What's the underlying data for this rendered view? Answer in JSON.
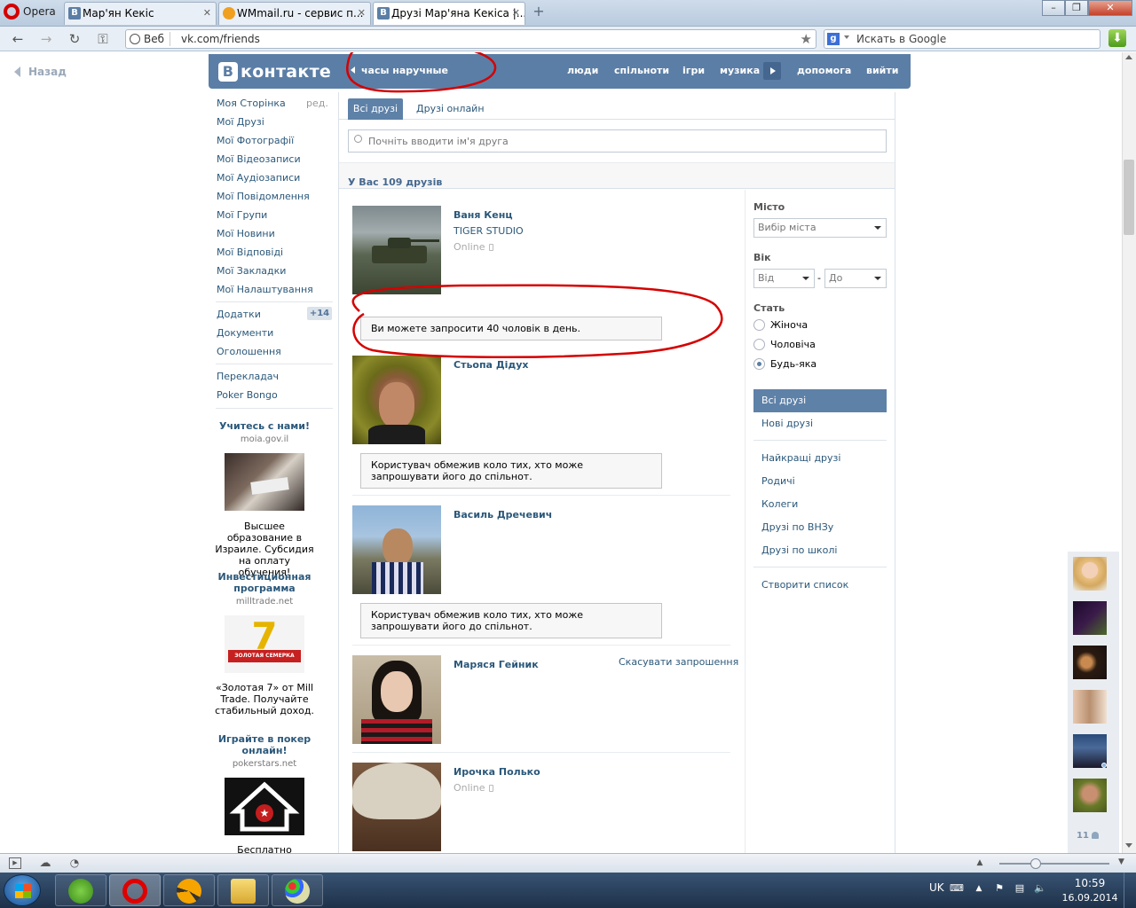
{
  "browser": {
    "menu_label": "Opera",
    "tabs": [
      {
        "label": "Мар'ян Кекіс",
        "icon": "vk-icon"
      },
      {
        "label": "WMmail.ru - сервис п...",
        "icon": "wmmail-icon"
      },
      {
        "label": "Друзі Мар'яна Кекіса |...",
        "icon": "vk-icon",
        "active": true
      }
    ],
    "web_label": "Веб",
    "url": "vk.com/friends",
    "search_placeholder": "Искать в Google"
  },
  "page": {
    "back_label": "Назад"
  },
  "vk_header": {
    "logo_text": "контакте",
    "logo_letter": "В",
    "now_playing": "часы наручные",
    "nav": [
      "люди",
      "спільноти",
      "ігри",
      "музика",
      "допомога",
      "вийти"
    ]
  },
  "left_menu": {
    "items": [
      "Моя Сторінка",
      "Мої Друзі",
      "Мої Фотографії",
      "Мої Відеозаписи",
      "Мої Аудіозаписи",
      "Мої Повідомлення",
      "Мої Групи",
      "Мої Новини",
      "Мої Відповіді",
      "Мої Закладки",
      "Мої Налаштування"
    ],
    "edit_label": "ред.",
    "extra_items": [
      "Додатки",
      "Документи",
      "Оголошення"
    ],
    "apps_badge": "+14",
    "more_items": [
      "Перекладач",
      "Poker Bongo"
    ]
  },
  "ads": [
    {
      "title": "Учитесь с нами!",
      "domain": "moia.gov.il",
      "text": "Высшее образование в Израиле. Субсидия на оплату обучения!"
    },
    {
      "title": "Инвестиционная программа",
      "domain": "milltrade.net",
      "text": "«Золотая 7» от Mill Trade. Получайте стабильный доход.",
      "img_text": "ЗОЛОТАЯ СЕМЕРКА"
    },
    {
      "title": "Играйте в покер онлайн!",
      "domain": "pokerstars.net",
      "text": "Бесплатно скачайте"
    }
  ],
  "friends_page": {
    "tabs": [
      "Всі друзі",
      "Друзі онлайн"
    ],
    "search_placeholder": "Почніть вводити ім'я друга",
    "count_label": "У Вас 109 друзів",
    "friends": [
      {
        "name": "Ваня Кенц",
        "sub": "TIGER STUDIO",
        "status": "Online"
      },
      {
        "name": "Стьопа Дідух"
      },
      {
        "name": "Василь Дречевич"
      },
      {
        "name": "Маряся Гейник",
        "action": "Скасувати запрошення"
      },
      {
        "name": "Ирочка Полько",
        "status": "Online"
      }
    ],
    "tips": [
      "Ви можете запросити 40 чоловік в день.",
      "Користувач обмежив коло тих, хто може запрошувати його до спільнот.",
      "Користувач обмежив коло тих, хто може запрошувати його до спільнот."
    ]
  },
  "filters": {
    "city_label": "Місто",
    "city_value": "Вибір міста",
    "age_label": "Вік",
    "age_from": "Від",
    "age_sep": "-",
    "age_to": "До",
    "gender_label": "Стать",
    "gender_options": [
      "Жіноча",
      "Чоловіча",
      "Будь-яка"
    ],
    "gender_selected": "Будь-яка",
    "lists": [
      "Всі друзі",
      "Нові друзі"
    ],
    "lists2": [
      "Найкращі друзі",
      "Родичі",
      "Колеги",
      "Друзі по ВНЗу",
      "Друзі по школі"
    ],
    "create_list": "Створити список"
  },
  "online_friends": {
    "count": "11"
  },
  "taskbar": {
    "lang": "UK",
    "time": "10:59",
    "date": "16.09.2014"
  },
  "colors": {
    "vk_blue": "#5b7ea6",
    "link": "#2b587a",
    "annotation_red": "#d50000"
  }
}
